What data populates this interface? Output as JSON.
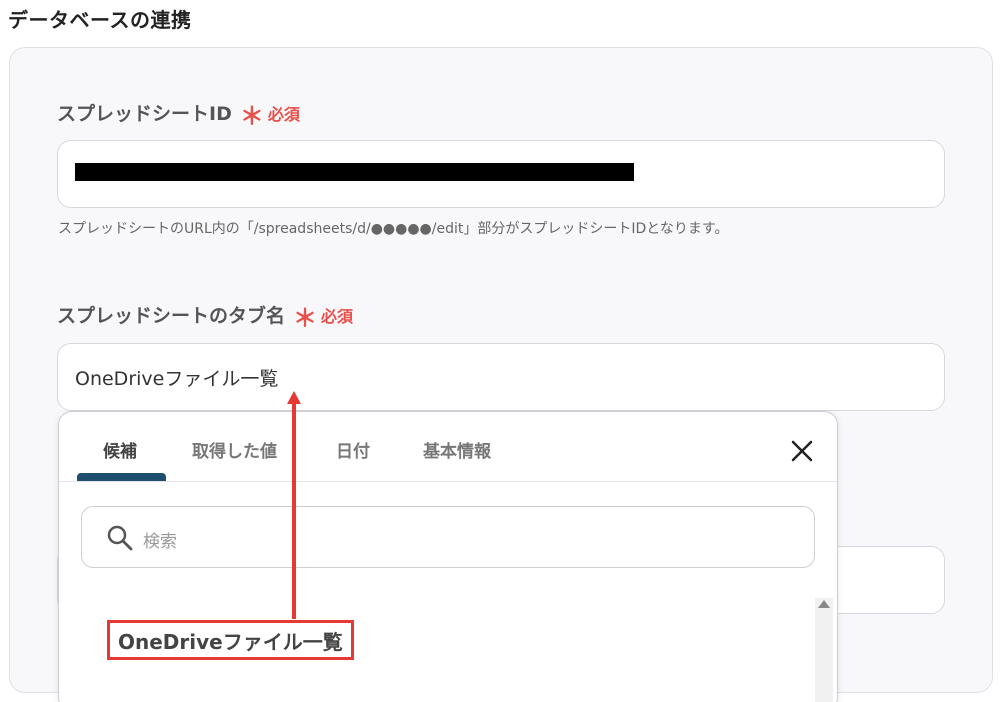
{
  "section": {
    "title": "データベースの連携"
  },
  "fields": {
    "spreadsheet_id": {
      "label": "スプレッドシートID",
      "required_mark": "＊",
      "required_text": "必須",
      "hint": "スプレッドシートのURL内の「/spreadsheets/d/●●●●●/edit」部分がスプレッドシートIDとなります。"
    },
    "tab_name": {
      "label": "スプレッドシートのタブ名",
      "required_mark": "＊",
      "required_text": "必須",
      "value": "OneDriveファイル一覧"
    }
  },
  "dropdown": {
    "tabs": [
      "候補",
      "取得した値",
      "日付",
      "基本情報"
    ],
    "active_tab": "候補",
    "search_placeholder": "検索",
    "candidates": [
      "OneDriveファイル一覧"
    ]
  },
  "colors": {
    "required": "#e8504a",
    "tab_underline": "#1e4f6e",
    "highlight_annotation": "#e53935"
  }
}
